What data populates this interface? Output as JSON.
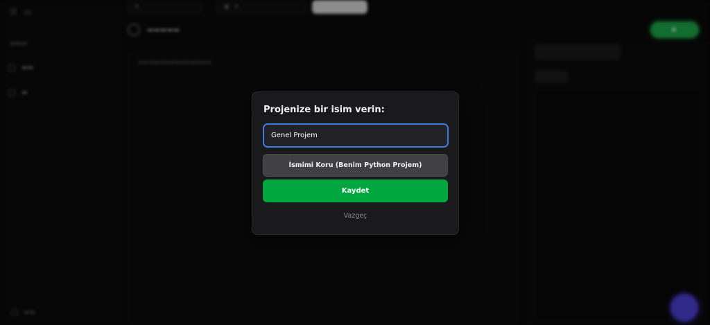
{
  "dialog": {
    "title": "Projenize bir isim verin:",
    "name_input_value": "Genel Projem",
    "keep_name_label": "İsmimi Koru (Benim Python Projem)",
    "save_label": "Kaydet",
    "cancel_label": "Vazgeç"
  },
  "colors": {
    "accent_focus": "#3d7de0",
    "save_green": "#00a63e",
    "modal_bg": "#1a1a1c",
    "run_green": "#1ea64a",
    "help_purple": "#4b3fd0"
  }
}
